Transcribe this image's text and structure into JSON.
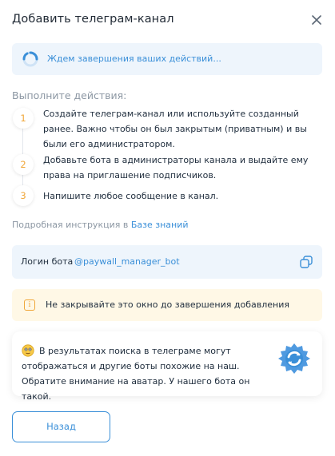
{
  "dialog": {
    "title": "Добавить телеграм-канал"
  },
  "status": {
    "text": "Ждем завершения ваших действий..."
  },
  "steps": {
    "heading": "Выполните действия:",
    "items": [
      {
        "number": "1",
        "text": "Создайте телеграм-канал или используйте созданный ранее. Важно чтобы он был закрытым (приватным) и вы были его администратором."
      },
      {
        "number": "2",
        "text": "Добавьте бота в администраторы канала и выдайте ему права на приглашение подписчиков."
      },
      {
        "number": "3",
        "text": "Напишите любое сообщение в канал."
      }
    ]
  },
  "instructions": {
    "prefix": "Подробная инструкция в",
    "link": "Базе знаний"
  },
  "bot_login": {
    "label": "Логин бота",
    "value": "@paywall_manager_bot"
  },
  "warning": {
    "text": "Не закрывайте это окно до завершения добавления"
  },
  "tip": {
    "text": "В результатах поиска в телеграме могут отображаться и другие боты похожие на наш. Обратите внимание на аватар. У нашего бота он такой."
  },
  "footer": {
    "back_label": "Назад"
  },
  "colors": {
    "accent": "#3a8fd8",
    "step_number": "#f0a73a",
    "status_bg": "#eef5fc",
    "warning_bg": "#fff8e6"
  }
}
